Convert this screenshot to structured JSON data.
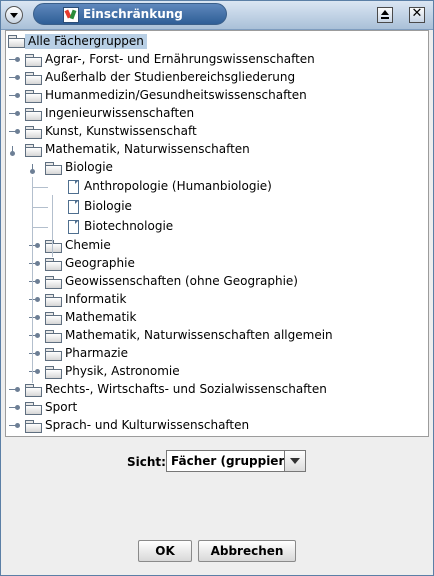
{
  "window": {
    "title": "Einschränkung",
    "icon": "app-logo-icon",
    "controls": [
      "window-menu-icon",
      "maximize-icon",
      "close-icon"
    ]
  },
  "tree": {
    "root": "Alle Fächergruppen",
    "items": [
      {
        "label": "Agrar-, Forst- und Ernährungswissenschaften",
        "type": "folder",
        "expanded": false,
        "level": 1
      },
      {
        "label": "Außerhalb der Studienbereichsgliederung",
        "type": "folder",
        "expanded": false,
        "level": 1
      },
      {
        "label": "Humanmedizin/Gesundheitswissenschaften",
        "type": "folder",
        "expanded": false,
        "level": 1
      },
      {
        "label": "Ingenieurwissenschaften",
        "type": "folder",
        "expanded": false,
        "level": 1
      },
      {
        "label": "Kunst, Kunstwissenschaft",
        "type": "folder",
        "expanded": false,
        "level": 1
      },
      {
        "label": "Mathematik, Naturwissenschaften",
        "type": "folder",
        "expanded": true,
        "level": 1
      },
      {
        "label": "Biologie",
        "type": "folder",
        "expanded": true,
        "level": 2
      },
      {
        "label": "Anthropologie (Humanbiologie)",
        "type": "leaf",
        "level": 3
      },
      {
        "label": "Biologie",
        "type": "leaf",
        "level": 3
      },
      {
        "label": "Biotechnologie",
        "type": "leaf",
        "level": 3
      },
      {
        "label": "Chemie",
        "type": "folder",
        "expanded": false,
        "level": 2
      },
      {
        "label": "Geographie",
        "type": "folder",
        "expanded": false,
        "level": 2
      },
      {
        "label": "Geowissenschaften (ohne Geographie)",
        "type": "folder",
        "expanded": false,
        "level": 2
      },
      {
        "label": "Informatik",
        "type": "folder",
        "expanded": false,
        "level": 2
      },
      {
        "label": "Mathematik",
        "type": "folder",
        "expanded": false,
        "level": 2
      },
      {
        "label": "Mathematik, Naturwissenschaften allgemein",
        "type": "folder",
        "expanded": false,
        "level": 2
      },
      {
        "label": "Pharmazie",
        "type": "folder",
        "expanded": false,
        "level": 2
      },
      {
        "label": "Physik, Astronomie",
        "type": "folder",
        "expanded": false,
        "level": 2
      },
      {
        "label": "Rechts-, Wirtschafts- und Sozialwissenschaften",
        "type": "folder",
        "expanded": false,
        "level": 1
      },
      {
        "label": "Sport",
        "type": "folder",
        "expanded": false,
        "level": 1
      },
      {
        "label": "Sprach- und Kulturwissenschaften",
        "type": "folder",
        "expanded": false,
        "level": 1
      }
    ]
  },
  "view": {
    "label": "Sicht:",
    "selected": "Fächer (gruppiert)"
  },
  "buttons": {
    "ok": "OK",
    "cancel": "Abbrechen"
  },
  "colors": {
    "title_pill": "#3d6aa3",
    "selection": "#b8cfe5",
    "tree_lines": "#b3bfcd"
  }
}
